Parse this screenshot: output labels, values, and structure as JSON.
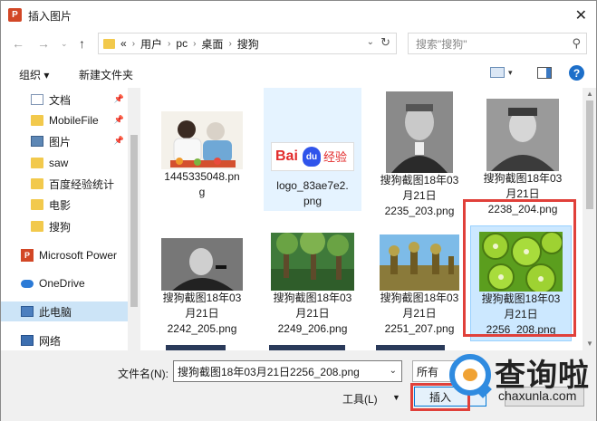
{
  "window": {
    "title": "插入图片",
    "app_icon": "P"
  },
  "nav": {
    "breadcrumb_prefix": "«",
    "breadcrumbs": [
      "用户",
      "pc",
      "桌面",
      "搜狗"
    ],
    "search_placeholder": "搜索\"搜狗\""
  },
  "toolbar": {
    "organize": "组织 ▾",
    "new_folder": "新建文件夹"
  },
  "sidebar": {
    "items": [
      {
        "label": "文档",
        "icon": "document-icon",
        "pinned": true
      },
      {
        "label": "MobileFile",
        "icon": "folder-icon",
        "pinned": true
      },
      {
        "label": "图片",
        "icon": "pictures-icon",
        "pinned": true
      },
      {
        "label": "saw",
        "icon": "folder-icon",
        "pinned": false
      },
      {
        "label": "百度经验统计",
        "icon": "folder-icon",
        "pinned": false
      },
      {
        "label": "电影",
        "icon": "folder-icon",
        "pinned": false
      },
      {
        "label": "搜狗",
        "icon": "folder-icon",
        "pinned": false
      },
      {
        "label": "Microsoft Power",
        "icon": "powerpoint-icon",
        "pinned": false
      },
      {
        "label": "OneDrive",
        "icon": "cloud-icon",
        "pinned": false
      },
      {
        "label": "此电脑",
        "icon": "computer-icon",
        "pinned": false
      },
      {
        "label": "网络",
        "icon": "network-icon",
        "pinned": false
      }
    ]
  },
  "files": [
    {
      "name": "1445335048.png",
      "lines": [
        "1445335048.pn",
        "g"
      ]
    },
    {
      "name": "logo_83ae7e2.png",
      "lines": [
        "logo_83ae7e2.",
        "png"
      ],
      "logo_text": "Bai",
      "logo_paw": "du",
      "logo_suffix": "经验"
    },
    {
      "name": "搜狗截图18年03月21日2235_203.png",
      "lines": [
        "搜狗截图18年03",
        "月21日",
        "2235_203.png"
      ]
    },
    {
      "name": "搜狗截图18年03月21日2238_204.png",
      "lines": [
        "搜狗截图18年03",
        "月21日",
        "2238_204.png"
      ]
    },
    {
      "name": "搜狗截图18年03月21日2242_205.png",
      "lines": [
        "搜狗截图18年03",
        "月21日",
        "2242_205.png"
      ]
    },
    {
      "name": "搜狗截图18年03月21日2249_206.png",
      "lines": [
        "搜狗截图18年03",
        "月21日",
        "2249_206.png"
      ]
    },
    {
      "name": "搜狗截图18年03月21日2251_207.png",
      "lines": [
        "搜狗截图18年03",
        "月21日",
        "2251_207.png"
      ]
    },
    {
      "name": "搜狗截图18年03月21日2256_208.png",
      "lines": [
        "搜狗截图18年03",
        "月21日",
        "2256_208.png"
      ]
    }
  ],
  "bottom": {
    "filename_label": "文件名(N):",
    "filename_value": "搜狗截图18年03月21日2256_208.png",
    "filetype_value": "所有",
    "tools_label": "工具(L)",
    "insert_label": "插入",
    "cancel_label": ""
  },
  "watermark": {
    "brand": "查询啦",
    "url": "chaxunla.com"
  },
  "colors": {
    "accent": "#0078d7",
    "highlight": "#e0403a",
    "selection": "#cce8ff"
  }
}
